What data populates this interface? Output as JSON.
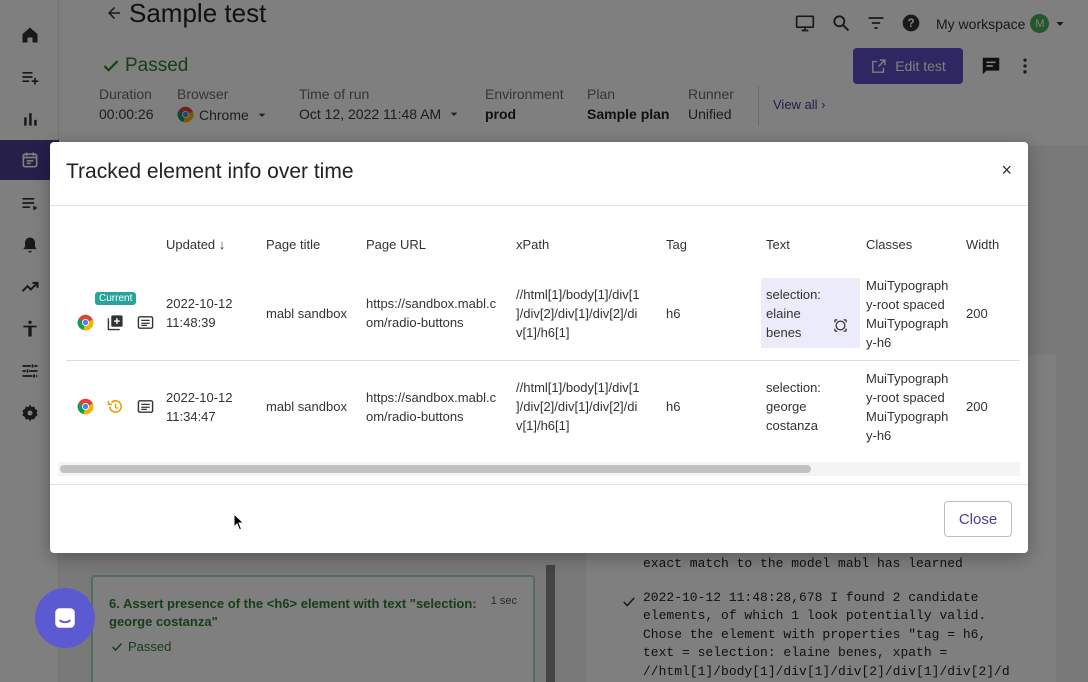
{
  "header": {
    "title": "Sample test",
    "status": "Passed",
    "meta": {
      "duration_label": "Duration",
      "duration": "00:00:26",
      "browser_label": "Browser",
      "browser": "Chrome",
      "time_label": "Time of run",
      "time": "Oct 12, 2022 11:48 AM",
      "environment_label": "Environment",
      "environment": "prod",
      "plan_label": "Plan",
      "plan": "Sample plan",
      "runner_label": "Runner",
      "runner": "Unified"
    },
    "view_all": "View all",
    "workspace": "My workspace",
    "workspace_avatar": "M",
    "edit_test": "Edit test"
  },
  "background": {
    "step_text": "6. Assert presence of the <h6> element with text \"selection: george costanza\"",
    "step_time": "1 sec",
    "step_status": "Passed",
    "log_lines": [
      "exact match to the model mabl has learned",
      "2022-10-12 11:48:28,678 I found 2 candidate",
      "elements, of which 1 look potentially valid.",
      "Chose the element with properties \"tag = h6,",
      "text = selection: elaine benes, xpath =",
      "//html[1]/body[1]/div[1]/div[2]/div[1]/div[2]/d"
    ]
  },
  "modal": {
    "title": "Tracked element info over time",
    "close_x": "×",
    "columns": [
      "Updated",
      "Page title",
      "Page URL",
      "xPath",
      "Tag",
      "Text",
      "Classes",
      "Width"
    ],
    "sort_arrow": "↓",
    "current_badge": "Current",
    "rows": [
      {
        "updated": [
          "2022-10-12",
          "11:48:39"
        ],
        "page_title": "mabl sandbox",
        "page_url": [
          "https://sandbox.mabl.c",
          "om/radio-buttons"
        ],
        "xpath": [
          "//html[1]/body[1]/div[1",
          "]/div[2]/div[1]/div[2]/di",
          "v[1]/h6[1]"
        ],
        "tag": "h6",
        "text": [
          "selection:",
          "elaine",
          "benes"
        ],
        "classes": [
          "MuiTypograph",
          "y-root spaced",
          "MuiTypograph",
          "y-h6"
        ],
        "width": "200"
      },
      {
        "updated": [
          "2022-10-12",
          "11:34:47"
        ],
        "page_title": "mabl sandbox",
        "page_url": [
          "https://sandbox.mabl.c",
          "om/radio-buttons"
        ],
        "xpath": [
          "//html[1]/body[1]/div[1",
          "]/div[2]/div[1]/div[2]/di",
          "v[1]/h6[1]"
        ],
        "tag": "h6",
        "text": [
          "selection:",
          "george",
          "costanza"
        ],
        "classes": [
          "MuiTypograph",
          "y-root spaced",
          "MuiTypograph",
          "y-h6"
        ],
        "width": "200"
      }
    ],
    "close_button": "Close"
  },
  "colors": {
    "brand": "#5c4fc4",
    "passed": "#2e7d32",
    "badge": "#26a69a"
  }
}
